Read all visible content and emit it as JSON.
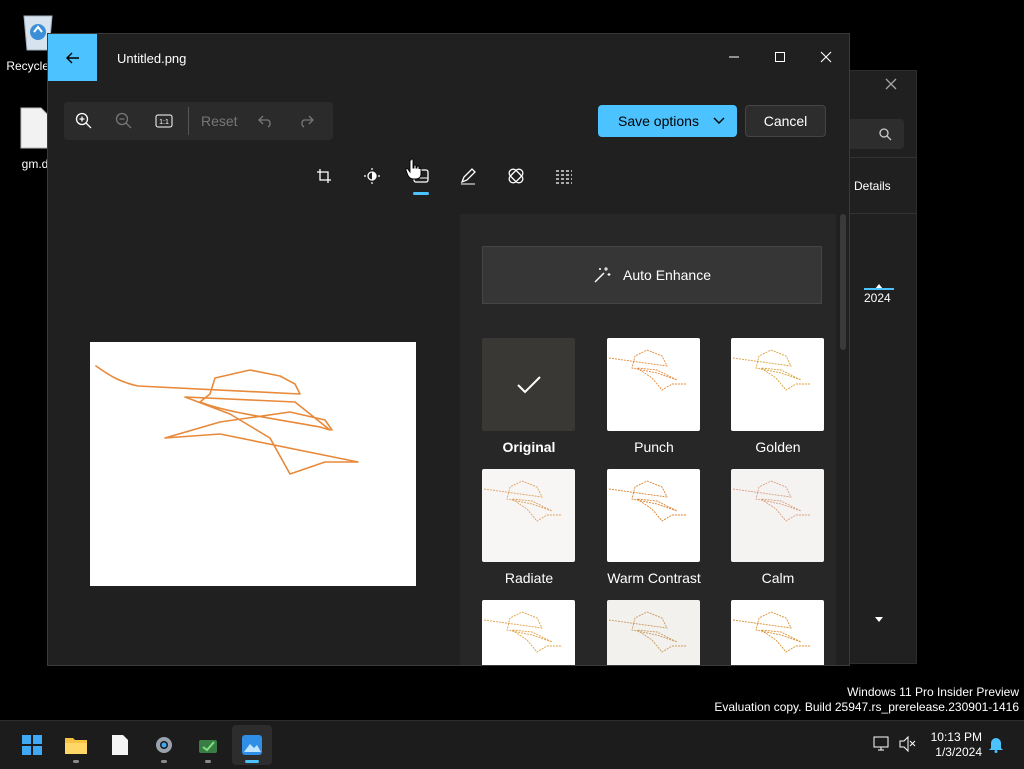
{
  "desktop": {
    "icons": [
      {
        "label": "Recycle Bin",
        "icon": "recycle-bin-icon"
      },
      {
        "label": "gm.d",
        "icon": "file-icon"
      }
    ]
  },
  "background_window": {
    "details_label": "Details",
    "year_label": "2024"
  },
  "editor": {
    "title": "Untitled.png",
    "toolbar": {
      "reset_label": "Reset",
      "save_label": "Save options",
      "cancel_label": "Cancel"
    },
    "tools": [
      "crop-icon",
      "adjustment-icon",
      "filter-icon",
      "markup-icon",
      "retouch-icon",
      "background-icon"
    ],
    "panel": {
      "auto_enhance_label": "Auto Enhance",
      "filters": [
        {
          "label": "Original",
          "selected": true
        },
        {
          "label": "Punch"
        },
        {
          "label": "Golden"
        },
        {
          "label": "Radiate"
        },
        {
          "label": "Warm Contrast"
        },
        {
          "label": "Calm"
        },
        {
          "label": ""
        },
        {
          "label": ""
        },
        {
          "label": ""
        }
      ]
    },
    "colors": {
      "accent": "#4cc2ff",
      "stroke": "#e8893a"
    }
  },
  "watermark": {
    "line1": "Windows 11 Pro Insider Preview",
    "line2": "Evaluation copy. Build 25947.rs_prerelease.230901-1416"
  },
  "taskbar": {
    "apps": [
      "start-icon",
      "file-explorer-icon",
      "notepad-icon",
      "settings-icon",
      "sniping-tool-icon",
      "photos-icon"
    ],
    "time": "10:13 PM",
    "date": "1/3/2024"
  }
}
